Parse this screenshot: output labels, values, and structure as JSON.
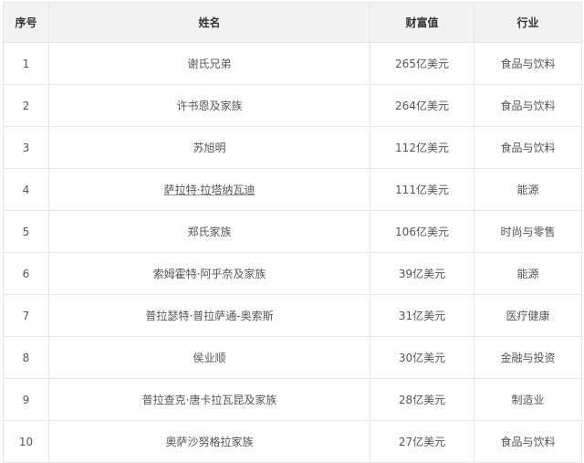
{
  "headers": [
    "序号",
    "姓名",
    "财富值",
    "行业"
  ],
  "rows": [
    {
      "rank": "1",
      "name": "谢氏兄弟",
      "wealth": "265亿美元",
      "industry": "食品与饮料"
    },
    {
      "rank": "2",
      "name": "许书恩及家族",
      "wealth": "264亿美元",
      "industry": "食品与饮料"
    },
    {
      "rank": "3",
      "name": "苏旭明",
      "wealth": "112亿美元",
      "industry": "食品与饮料"
    },
    {
      "rank": "4",
      "name": "萨拉特·拉塔纳瓦迪",
      "wealth": "111亿美元",
      "industry": "能源"
    },
    {
      "rank": "5",
      "name": "郑氏家族",
      "wealth": "106亿美元",
      "industry": "时尚与零售"
    },
    {
      "rank": "6",
      "name": "索姆霍特·阿乎奈及家族",
      "wealth": "39亿美元",
      "industry": "能源"
    },
    {
      "rank": "7",
      "name": "普拉瑟特·普拉萨通-奥索斯",
      "wealth": "31亿美元",
      "industry": "医疗健康"
    },
    {
      "rank": "8",
      "name": "侯业顺",
      "wealth": "30亿美元",
      "industry": "金融与投资"
    },
    {
      "rank": "9",
      "name": "普拉查克·唐卡拉瓦昆及家族",
      "wealth": "28亿美元",
      "industry": "制造业"
    },
    {
      "rank": "10",
      "name": "奥萨沙努格拉家族",
      "wealth": "27亿美元",
      "industry": "食品与饮料"
    }
  ]
}
